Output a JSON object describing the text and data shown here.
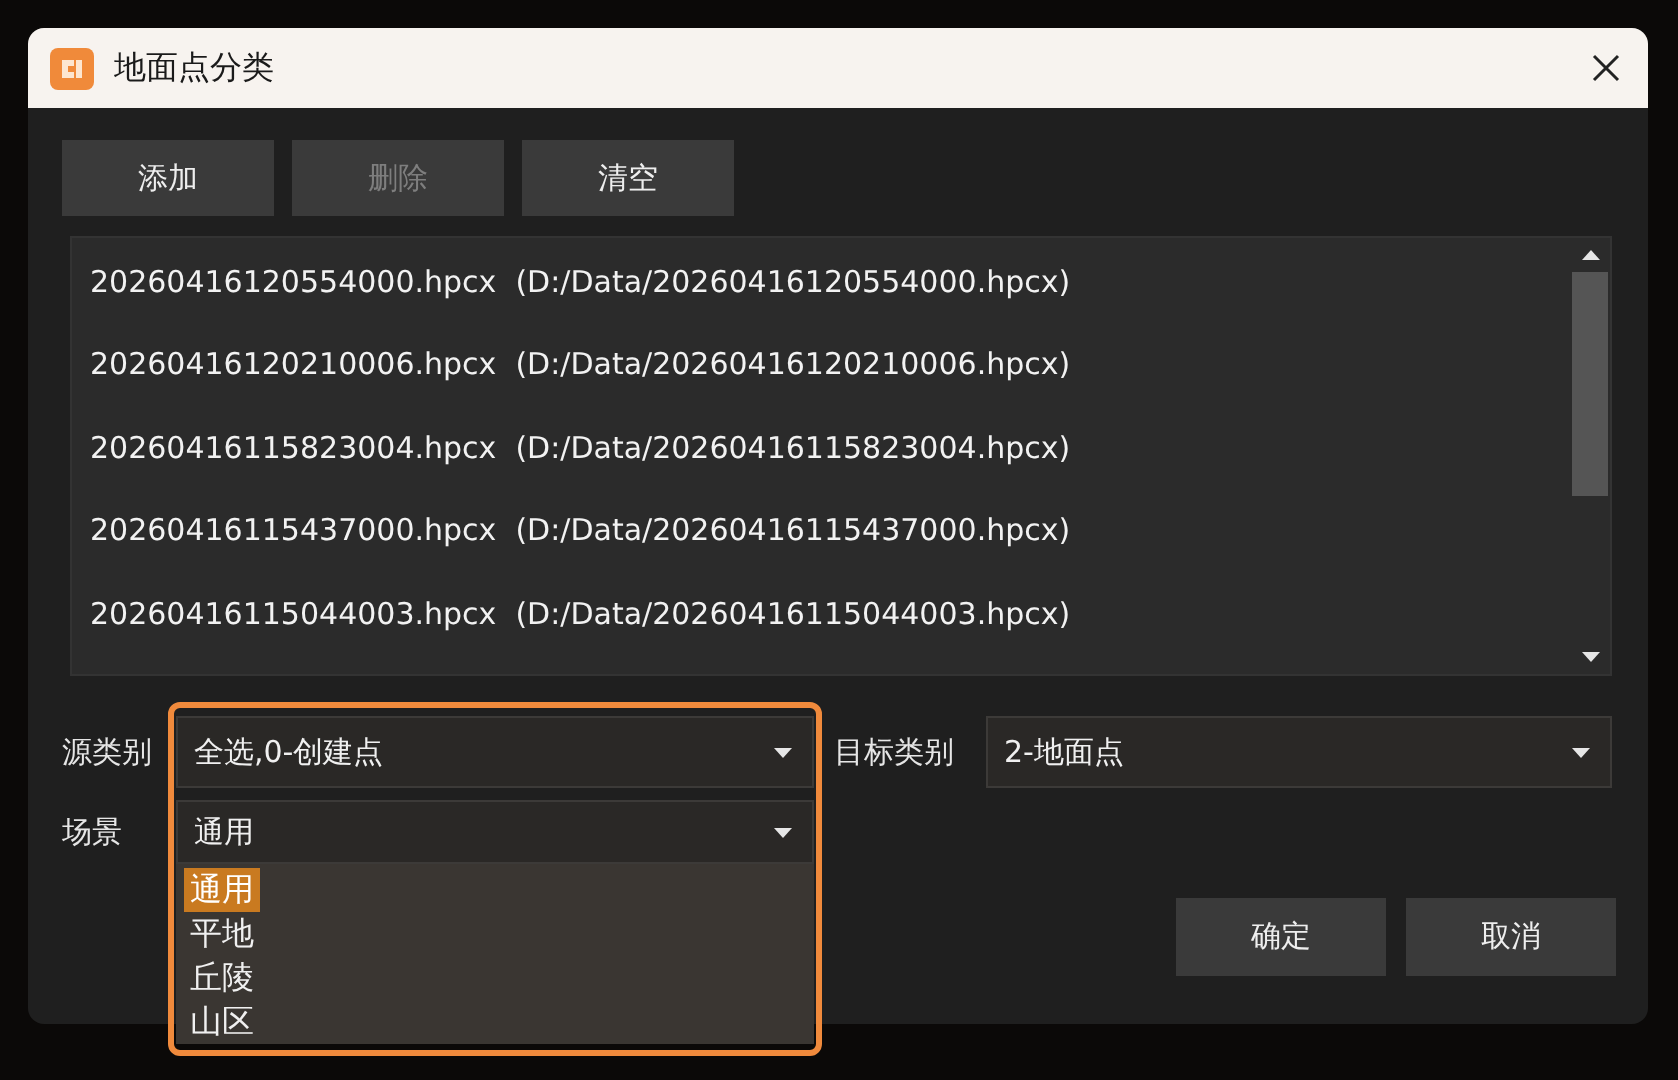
{
  "window": {
    "title": "地面点分类"
  },
  "toolbar": [
    {
      "label": "添加",
      "disabled": false
    },
    {
      "label": "删除",
      "disabled": true
    },
    {
      "label": "清空",
      "disabled": false
    }
  ],
  "files": [
    "20260416120554000.hpcx  (D:/Data/20260416120554000.hpcx)",
    "20260416120210006.hpcx  (D:/Data/20260416120210006.hpcx)",
    "20260416115823004.hpcx  (D:/Data/20260416115823004.hpcx)",
    "20260416115437000.hpcx  (D:/Data/20260416115437000.hpcx)",
    "20260416115044003.hpcx  (D:/Data/20260416115044003.hpcx)"
  ],
  "source": {
    "label": "源类别",
    "value": "全选,0-创建点"
  },
  "target": {
    "label": "目标类别",
    "value": "2-地面点"
  },
  "scene": {
    "label": "场景",
    "value": "通用",
    "expanded": true,
    "options": [
      {
        "label": "通用",
        "selected": true
      },
      {
        "label": "平地",
        "selected": false
      },
      {
        "label": "丘陵",
        "selected": false
      },
      {
        "label": "山区",
        "selected": false
      }
    ]
  },
  "buttons": [
    "确定",
    "取消"
  ],
  "highlight": true
}
